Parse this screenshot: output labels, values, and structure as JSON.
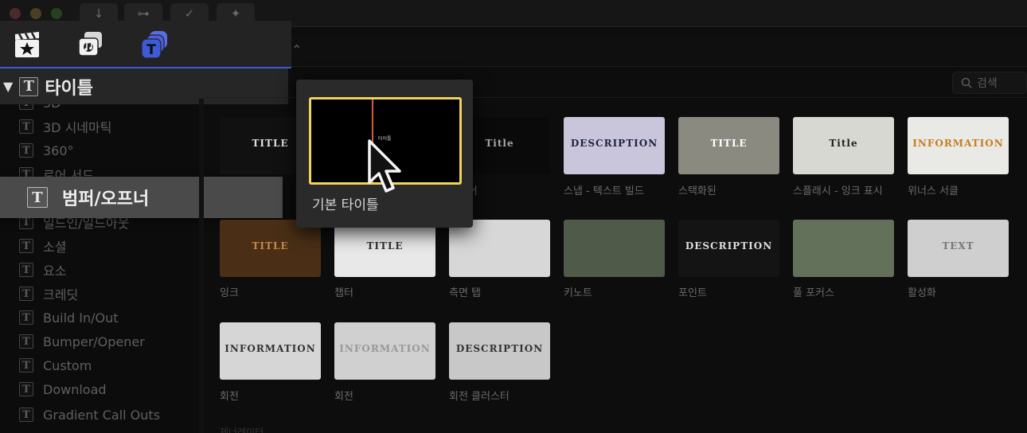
{
  "library_tabs": [
    {
      "name": "photos-video-tab",
      "icon": "clapper-star-icon"
    },
    {
      "name": "music-sound-tab",
      "icon": "camera-music-icon"
    },
    {
      "name": "titles-generators-tab",
      "icon": "titles-icon",
      "selected": true
    }
  ],
  "sidebar": {
    "header": "타이틀",
    "items": [
      {
        "label": "3D"
      },
      {
        "label": "3D 시네마틱"
      },
      {
        "label": "360°"
      },
      {
        "label": "로어 서드"
      },
      {
        "label": "범퍼/오프너",
        "highlighted": true
      },
      {
        "label": "일드인/일드아웃"
      },
      {
        "label": "소셜"
      },
      {
        "label": "요소"
      },
      {
        "label": "크레딧"
      },
      {
        "label": "Build In/Out"
      },
      {
        "label": "Bumper/Opener"
      },
      {
        "label": "Custom"
      },
      {
        "label": "Download"
      },
      {
        "label": "Gradient Call Outs"
      }
    ]
  },
  "search": {
    "placeholder": "검색"
  },
  "preview_popup": {
    "caption": "기본 타이틀",
    "frame_text": "타이틀"
  },
  "grid": {
    "row1": [
      {
        "label": "",
        "thumb_text": "TITLE"
      },
      {
        "label": "기본 타이틀"
      },
      {
        "label": "플레어",
        "thumb_text": "Title"
      },
      {
        "label": "스냅 - 텍스트 빌드",
        "thumb_text": "DESCRIPTION"
      },
      {
        "label": "스택화된",
        "thumb_text": "TITLE"
      },
      {
        "label": "스플래시 - 잉크 표시",
        "thumb_text": "Title"
      },
      {
        "label": "위너스 서클",
        "thumb_text": "INFORMATION"
      }
    ],
    "row2": [
      {
        "label": "잉크",
        "thumb_text": "TITLE"
      },
      {
        "label": "챕터",
        "thumb_text": "TITLE"
      },
      {
        "label": "측면 탭"
      },
      {
        "label": "키노트"
      },
      {
        "label": "포인트",
        "thumb_text": "DESCRIPTION"
      },
      {
        "label": "풀 포커스"
      },
      {
        "label": "활성화",
        "thumb_text": "TEXT"
      }
    ],
    "row3": [
      {
        "label": "회전",
        "thumb_text": "INFORMATION"
      },
      {
        "label": "회전",
        "thumb_text": "INFORMATION"
      },
      {
        "label": "회전 클러스터",
        "thumb_text": "DESCRIPTION"
      }
    ]
  },
  "section_next": "제너레이터",
  "colors": {
    "accent_blue": "#3d5bd6",
    "selection_yellow": "#f1d25b",
    "playhead_red": "#d35a3c"
  }
}
